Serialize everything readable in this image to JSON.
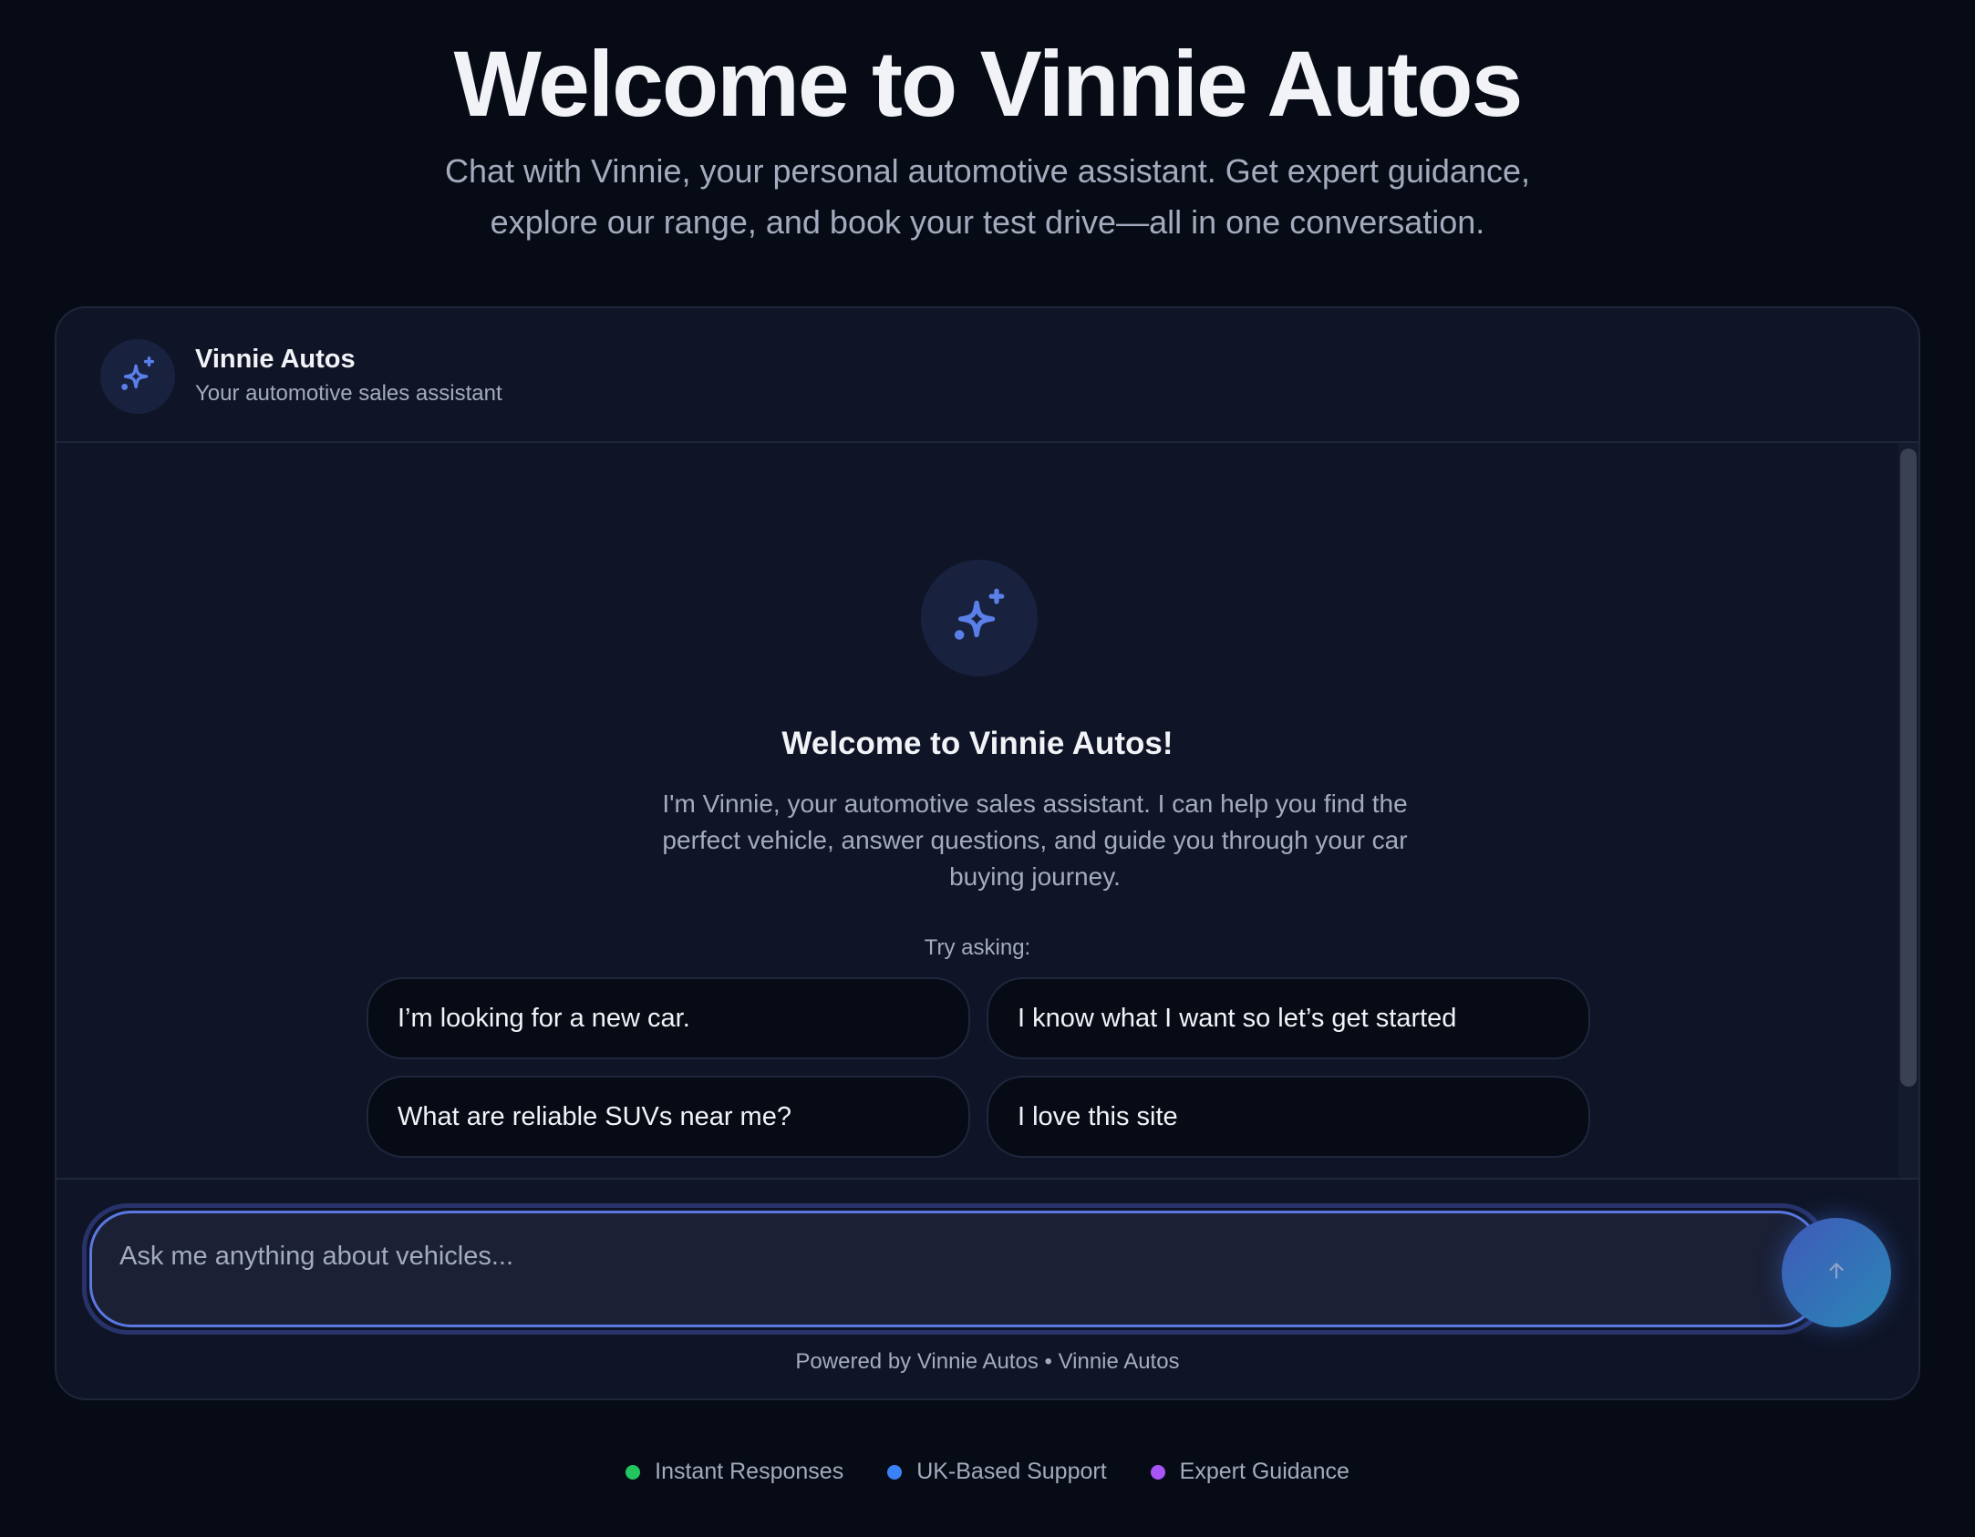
{
  "hero": {
    "title": "Welcome to Vinnie Autos",
    "subtitle_line1": "Chat with Vinnie, your personal automotive assistant. Get expert guidance,",
    "subtitle_line2": "explore our range, and book your test drive—all in one conversation."
  },
  "chat": {
    "header": {
      "name": "Vinnie Autos",
      "subtitle": "Your automotive sales assistant",
      "icon": "sparkles-icon"
    },
    "welcome": {
      "icon": "sparkles-icon",
      "title": "Welcome to Vinnie Autos!",
      "text_line1": "I'm Vinnie, your automotive sales assistant. I can help you find the",
      "text_line2": "perfect vehicle, answer questions, and guide you through your car",
      "text_line3": "buying journey.",
      "try_label": "Try asking:",
      "suggestions": [
        "I’m looking for a new car.",
        "I know what I want so let’s get started",
        "What are reliable SUVs near me?",
        "I love this site"
      ]
    },
    "composer": {
      "placeholder": "Ask me anything about vehicles...",
      "value": "",
      "send_icon": "arrow-up-icon",
      "powered_by": "Powered by Vinnie Autos • Vinnie Autos"
    }
  },
  "features": [
    {
      "label": "Instant Responses",
      "color": "#22c55e"
    },
    {
      "label": "UK-Based Support",
      "color": "#3b82f6"
    },
    {
      "label": "Expert Guidance",
      "color": "#a855f7"
    }
  ],
  "colors": {
    "background": "#060b16",
    "card": "#0f1527",
    "accent": "#5a78e0"
  }
}
